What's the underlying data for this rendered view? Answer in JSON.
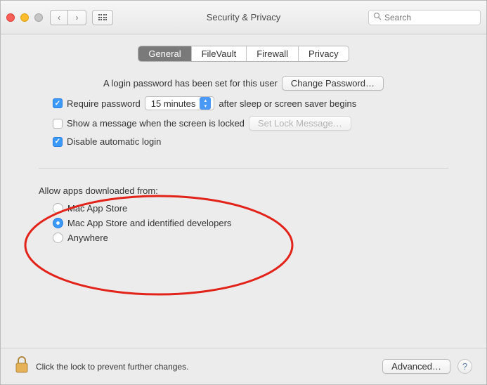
{
  "window": {
    "title": "Security & Privacy"
  },
  "search": {
    "placeholder": "Search"
  },
  "tabs": [
    {
      "label": "General",
      "active": true
    },
    {
      "label": "FileVault",
      "active": false
    },
    {
      "label": "Firewall",
      "active": false
    },
    {
      "label": "Privacy",
      "active": false
    }
  ],
  "login": {
    "intro": "A login password has been set for this user",
    "change_btn": "Change Password…",
    "require_label": "Require password",
    "require_after_label": "after sleep or screen saver begins",
    "delay_value": "15 minutes",
    "show_msg_label": "Show a message when the screen is locked",
    "set_lock_msg_btn": "Set Lock Message…",
    "disable_auto_label": "Disable automatic login",
    "checks": {
      "require": true,
      "show_msg": false,
      "disable_auto": true
    }
  },
  "gatekeeper": {
    "title": "Allow apps downloaded from:",
    "options": [
      {
        "label": "Mac App Store",
        "selected": false
      },
      {
        "label": "Mac App Store and identified developers",
        "selected": true
      },
      {
        "label": "Anywhere",
        "selected": false
      }
    ]
  },
  "footer": {
    "lock_text": "Click the lock to prevent further changes.",
    "advanced_btn": "Advanced…",
    "help": "?"
  }
}
